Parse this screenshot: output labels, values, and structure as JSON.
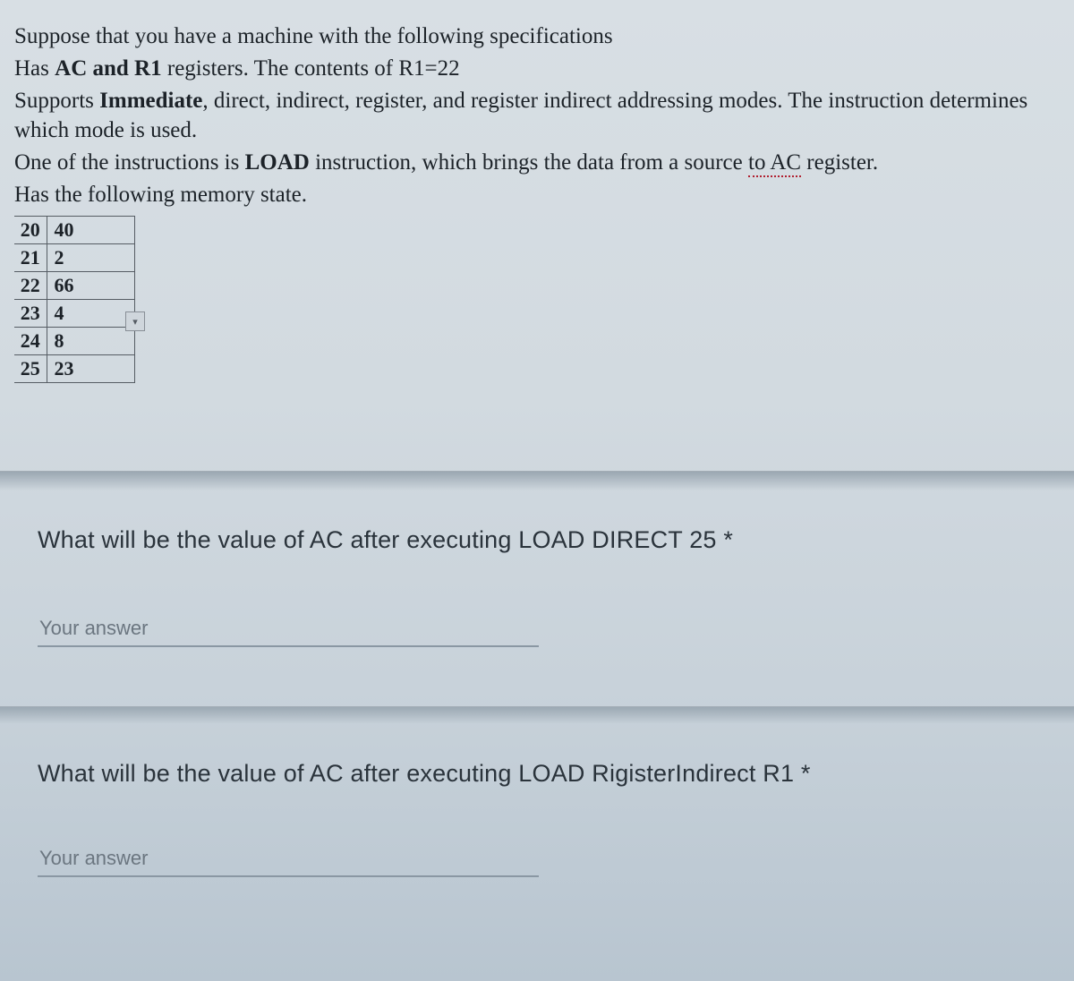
{
  "problem": {
    "line1_pre": "Suppose that you have a machine with the following specifications",
    "line2_pre": "Has ",
    "line2_bold": "AC and R1",
    "line2_post": " registers. The contents of R1=22",
    "line3_pre": "Supports ",
    "line3_bold": "Immediate",
    "line3_post": ", direct, indirect, register, and register indirect addressing  modes. The instruction determines which mode is used.",
    "line4_pre": "One of the instructions is ",
    "line4_bold": "LOAD",
    "line4_post": " instruction, which brings the data from a source ",
    "line4_underline": "to AC",
    "line4_end": " register.",
    "line5": "Has the following memory state."
  },
  "memory": {
    "rows": [
      {
        "addr": "20",
        "val": "40"
      },
      {
        "addr": "21",
        "val": "2"
      },
      {
        "addr": "22",
        "val": "66"
      },
      {
        "addr": "23",
        "val": "4"
      },
      {
        "addr": "24",
        "val": "8"
      },
      {
        "addr": "25",
        "val": "23"
      }
    ]
  },
  "questions": {
    "q1": {
      "text": "What will be the value of AC after executing LOAD DIRECT 25 *",
      "placeholder": "Your answer",
      "value": ""
    },
    "q2": {
      "text": "What will be the value of AC after executing LOAD RigisterIndirect R1 *",
      "placeholder": "Your answer",
      "value": ""
    }
  },
  "icons": {
    "dropdown": "▾"
  }
}
